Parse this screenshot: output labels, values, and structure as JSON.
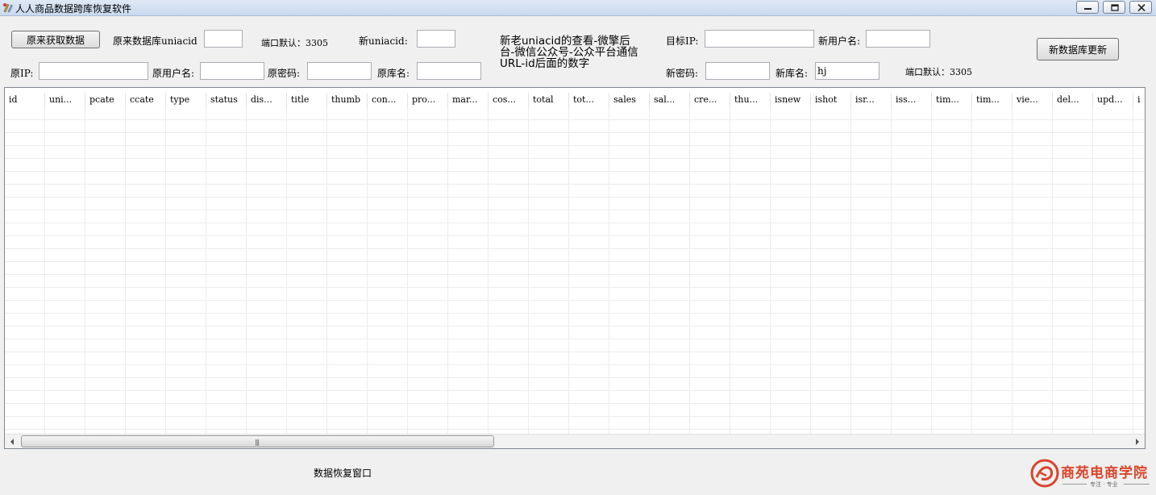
{
  "window": {
    "title": "人人商品数据跨库恢复软件"
  },
  "source": {
    "fetch_button": "原来获取数据",
    "uniacid_label": "原来数据库uniacid",
    "uniacid_value": "",
    "port_note": "端口默认：3305",
    "ip_label": "原IP:",
    "ip_value": "",
    "user_label": "原用户名:",
    "user_value": "",
    "password_label": "原密码:",
    "password_value": "",
    "db_label": "原库名:",
    "db_value": ""
  },
  "target": {
    "uniacid_label": "新uniacid:",
    "uniacid_value": "",
    "ip_label": "目标IP:",
    "ip_value": "",
    "user_label": "新用户名:",
    "user_value": "",
    "password_label": "新密码:",
    "password_value": "",
    "db_label": "新库名:",
    "db_value": "hj",
    "port_note": "端口默认：3305",
    "update_button": "新数据库更新"
  },
  "note": "新老uniacid的查看-微擎后台-微信公众号-公众平台通信URL-id后面的数字",
  "grid": {
    "columns": [
      "id",
      "uni...",
      "pcate",
      "ccate",
      "type",
      "status",
      "dis...",
      "title",
      "thumb",
      "con...",
      "pro...",
      "mar...",
      "cos...",
      "total",
      "tot...",
      "sales",
      "sal...",
      "cre...",
      "thu...",
      "isnew",
      "ishot",
      "isr...",
      "iss...",
      "tim...",
      "tim...",
      "vie...",
      "del...",
      "upd...",
      "i"
    ]
  },
  "status": {
    "text": "数据恢复窗口"
  },
  "logo": {
    "text": "商苑电商学院",
    "subtitle": "专注 · 专业"
  },
  "colors": {
    "logo": "#d9452b",
    "titlebar": "#d4e1f2"
  }
}
